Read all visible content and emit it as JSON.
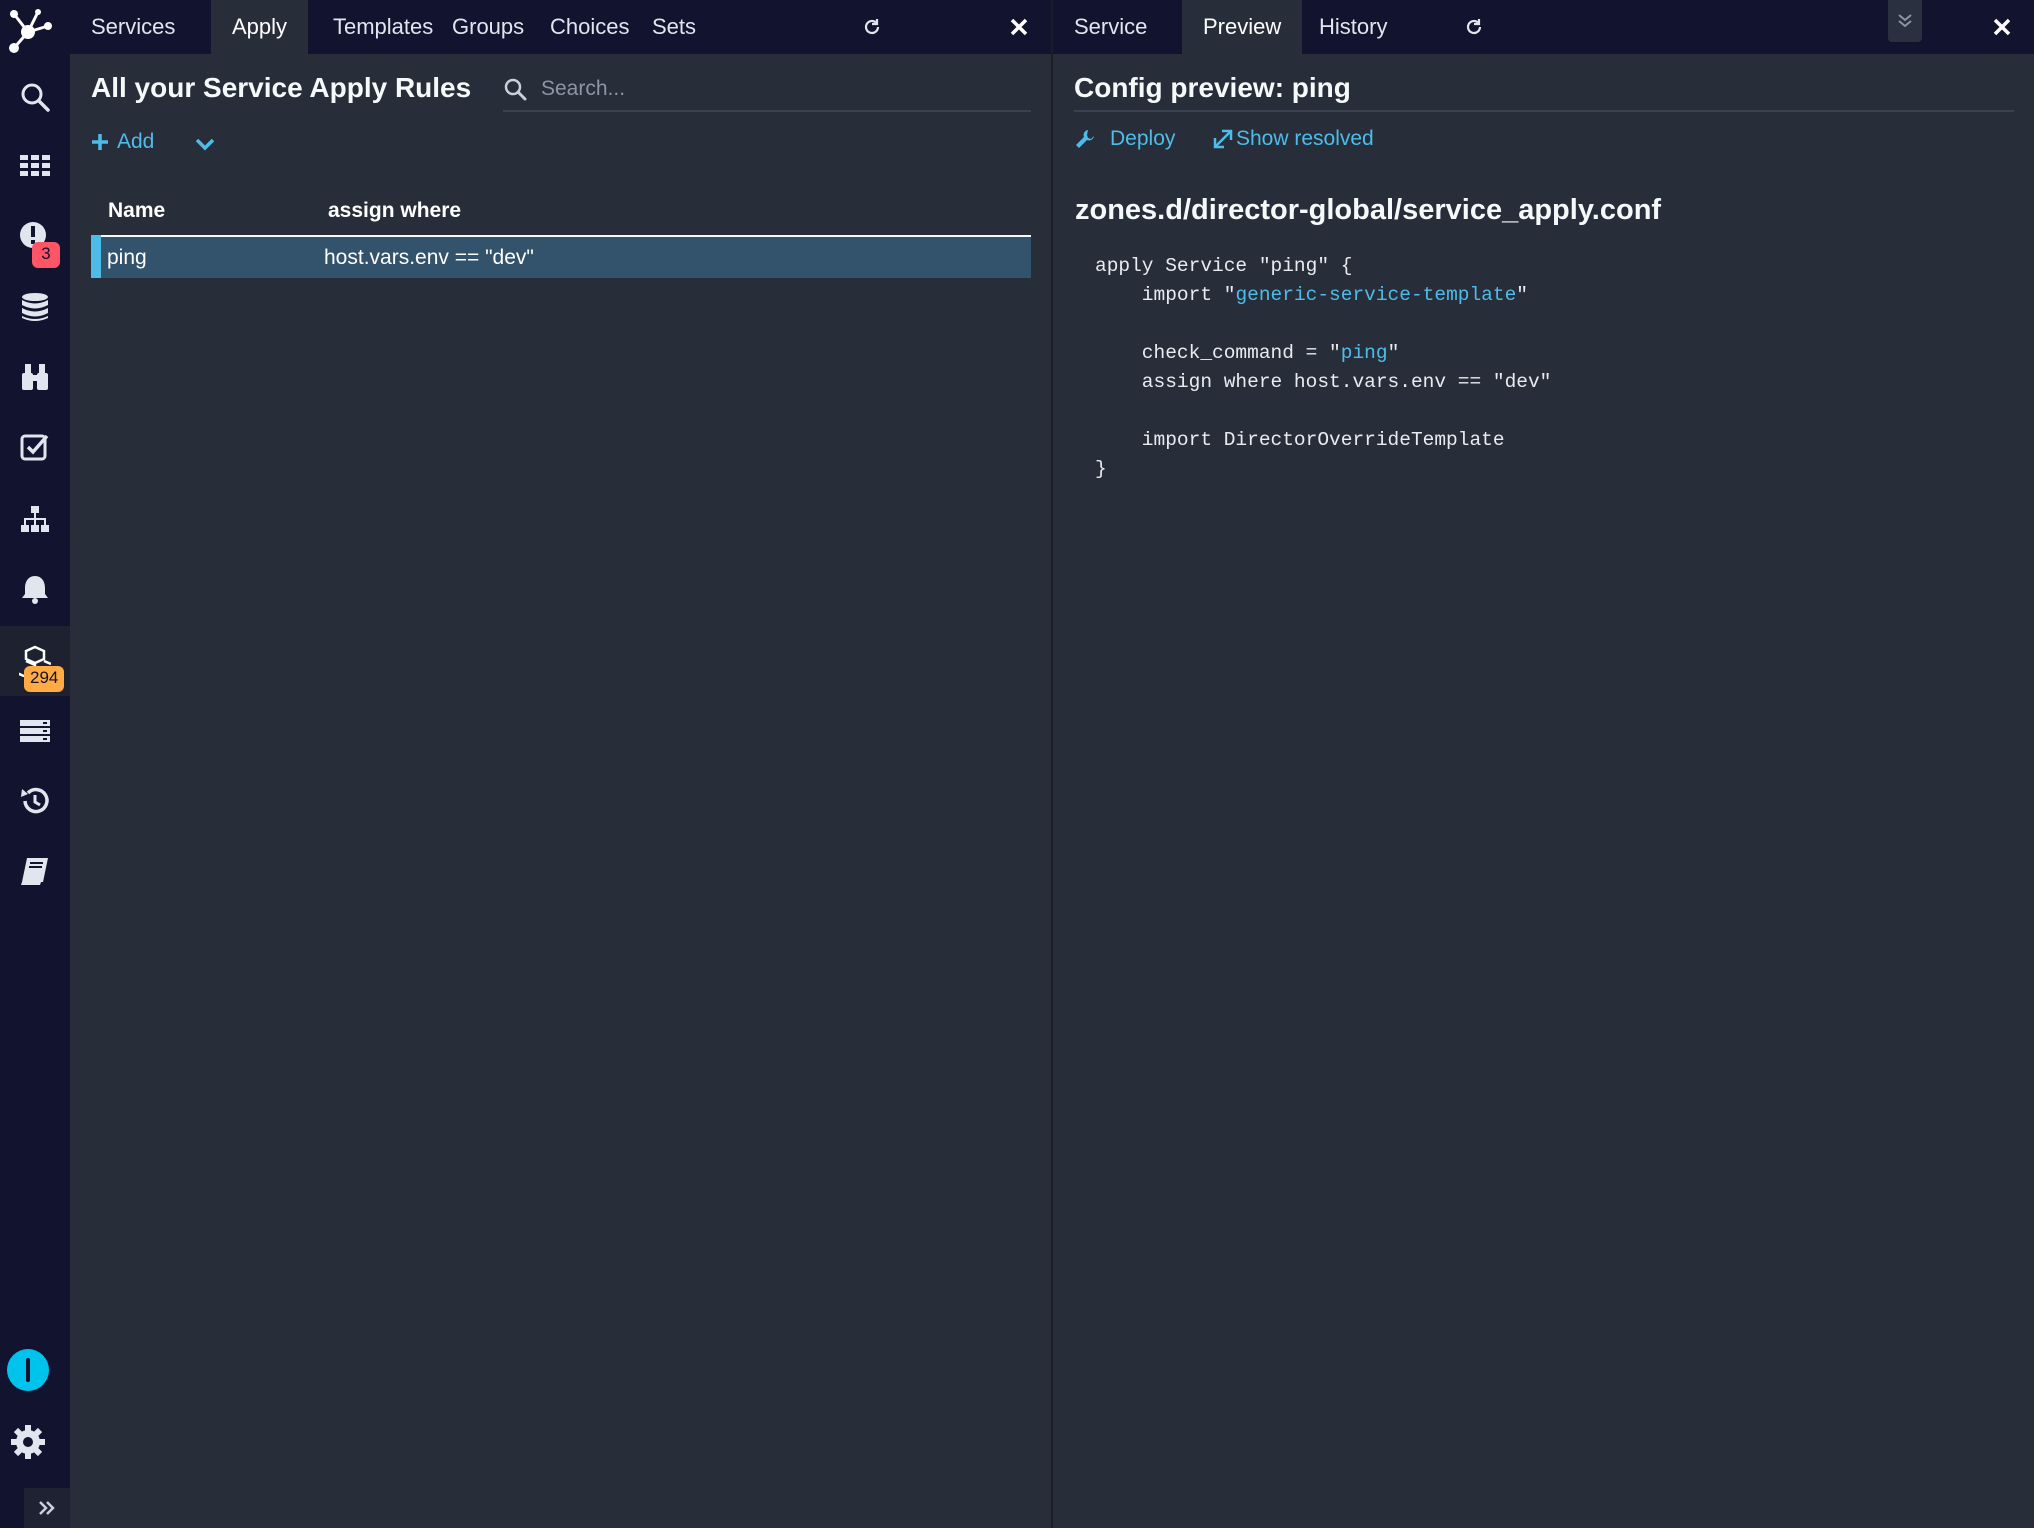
{
  "sidebar": {
    "items": [
      {
        "icon": "search-icon"
      },
      {
        "icon": "dashboard-grid-icon"
      },
      {
        "icon": "problems-icon",
        "badge": "3"
      },
      {
        "icon": "database-icon"
      },
      {
        "icon": "binoculars-icon"
      },
      {
        "icon": "checklist-icon"
      },
      {
        "icon": "hierarchy-icon"
      },
      {
        "icon": "bell-icon"
      },
      {
        "icon": "cubes-icon",
        "badge": "294",
        "active": true
      },
      {
        "icon": "server-rack-icon"
      },
      {
        "icon": "history-icon"
      },
      {
        "icon": "book-icon"
      }
    ],
    "bottom": [
      "user-icon",
      "gear-icon",
      "expand-icon"
    ]
  },
  "left": {
    "tabs": [
      "Services",
      "Apply",
      "Templates",
      "Groups",
      "Choices",
      "Sets"
    ],
    "active_tab": "Apply",
    "title": "All your Service Apply Rules",
    "search_placeholder": "Search...",
    "add_label": "Add",
    "table": {
      "columns": [
        "Name",
        "assign where"
      ],
      "rows": [
        {
          "name": "ping",
          "assign_where": "host.vars.env == \"dev\""
        }
      ]
    }
  },
  "right": {
    "tabs": [
      "Service",
      "Preview",
      "History"
    ],
    "active_tab": "Preview",
    "title": "Config preview: ping",
    "deploy_label": "Deploy",
    "show_resolved_label": "Show resolved",
    "file_name": "zones.d/director-global/service_apply.conf",
    "code": {
      "line1": "apply Service \"ping\" {",
      "import_prefix": "    import \"",
      "import_template": "generic-service-template",
      "check_prefix": "    check_command = \"",
      "check_command": "ping",
      "assign_line": "    assign where host.vars.env == \"dev\"",
      "override_line": "    import DirectorOverrideTemplate",
      "closing": "}"
    }
  },
  "colors": {
    "sidebar_bg": "#12132e",
    "content_bg": "#282e39",
    "accent": "#4dbce9",
    "selected_row": "#33526b",
    "badge_red": "#ff5566",
    "badge_orange": "#ffaa44"
  }
}
